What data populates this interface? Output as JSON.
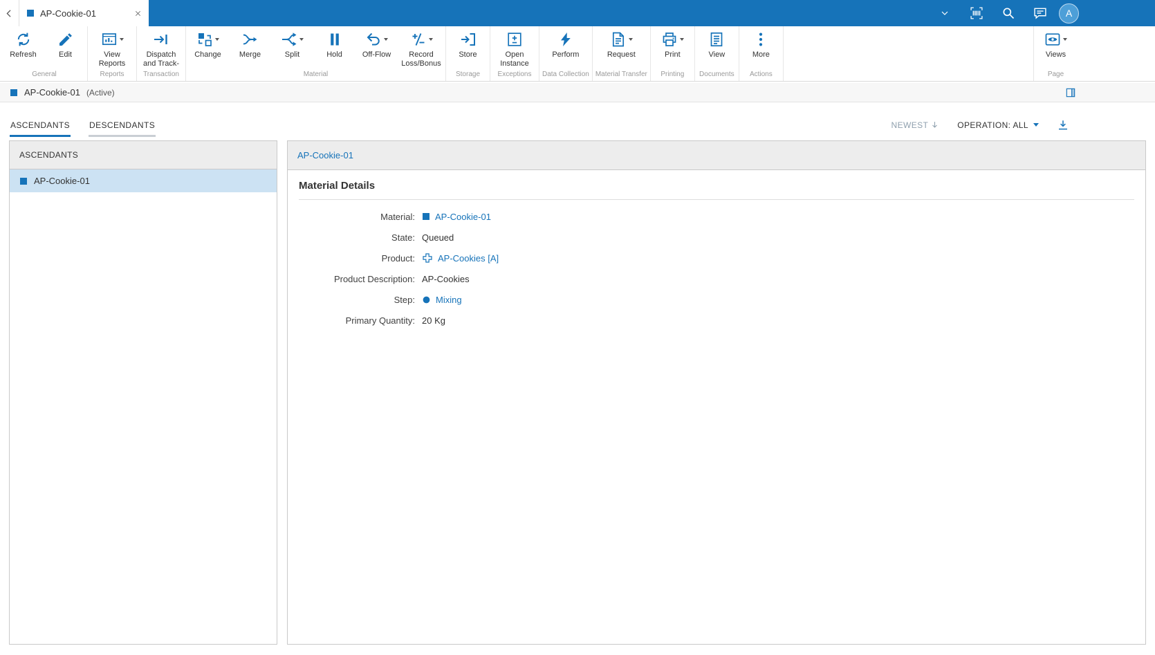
{
  "topbar": {
    "back_icon": "chevron-left",
    "tab": {
      "icon": "material-square",
      "title": "AP-Cookie-01",
      "close_icon": "close"
    },
    "icons": [
      "chevron-down",
      "barcode",
      "search",
      "chat"
    ],
    "avatar": "A"
  },
  "ribbon": {
    "groups": [
      {
        "label": "General",
        "buttons": [
          {
            "label": "Refresh",
            "icon": "refresh",
            "dropdown": false
          },
          {
            "label": "Edit",
            "icon": "edit",
            "dropdown": false
          }
        ]
      },
      {
        "label": "Reports",
        "buttons": [
          {
            "label": "View Reports",
            "icon": "view-reports",
            "dropdown": true
          }
        ]
      },
      {
        "label": "Transaction",
        "buttons": [
          {
            "label": "Dispatch and Track-",
            "icon": "dispatch",
            "dropdown": false
          }
        ]
      },
      {
        "label": "Material",
        "buttons": [
          {
            "label": "Change",
            "icon": "change",
            "dropdown": true
          },
          {
            "label": "Merge",
            "icon": "merge",
            "dropdown": false
          },
          {
            "label": "Split",
            "icon": "split",
            "dropdown": true
          },
          {
            "label": "Hold",
            "icon": "hold",
            "dropdown": false
          },
          {
            "label": "Off-Flow",
            "icon": "off-flow",
            "dropdown": true
          },
          {
            "label": "Record Loss/Bonus",
            "icon": "record-loss-bonus",
            "dropdown": true
          }
        ]
      },
      {
        "label": "Storage",
        "buttons": [
          {
            "label": "Store",
            "icon": "store",
            "dropdown": false
          }
        ]
      },
      {
        "label": "Exceptions",
        "buttons": [
          {
            "label": "Open Instance",
            "icon": "open-instance",
            "dropdown": false
          }
        ]
      },
      {
        "label": "Data Collection",
        "buttons": [
          {
            "label": "Perform",
            "icon": "perform",
            "dropdown": false
          }
        ]
      },
      {
        "label": "Material Transfer",
        "buttons": [
          {
            "label": "Request",
            "icon": "request",
            "dropdown": true
          }
        ]
      },
      {
        "label": "Printing",
        "buttons": [
          {
            "label": "Print",
            "icon": "print",
            "dropdown": true
          }
        ]
      },
      {
        "label": "Documents",
        "buttons": [
          {
            "label": "View",
            "icon": "view-documents",
            "dropdown": false
          }
        ]
      },
      {
        "label": "Actions",
        "buttons": [
          {
            "label": "More",
            "icon": "more",
            "dropdown": false
          }
        ]
      },
      {
        "label": "Page",
        "buttons": [
          {
            "label": "Views",
            "icon": "views",
            "dropdown": true
          }
        ]
      }
    ]
  },
  "titlebar": {
    "icon": "material-square",
    "title": "AP-Cookie-01",
    "status": "(Active)",
    "panel_icon": "panel-toggle"
  },
  "tabs": {
    "items": [
      {
        "label": "ASCENDANTS"
      },
      {
        "label": "DESCENDANTS"
      }
    ],
    "active": "ASCENDANTS",
    "sort_label": "NEWEST",
    "sort_icon": "arrow-down",
    "operation_label": "OPERATION: ALL",
    "download_icon": "download"
  },
  "left_panel": {
    "header": "ASCENDANTS",
    "items": [
      {
        "icon": "material-square",
        "label": "AP-Cookie-01",
        "selected": true
      }
    ]
  },
  "right_panel": {
    "header": "AP-Cookie-01",
    "section_title": "Material Details",
    "fields": [
      {
        "label": "Material:",
        "value": "AP-Cookie-01",
        "icon": "material-square",
        "link": true
      },
      {
        "label": "State:",
        "value": "Queued",
        "link": false
      },
      {
        "label": "Product:",
        "value": "AP-Cookies [A]",
        "icon": "product",
        "link": true
      },
      {
        "label": "Product Description:",
        "value": "AP-Cookies",
        "link": false
      },
      {
        "label": "Step:",
        "value": "Mixing",
        "icon": "step-circle",
        "link": true
      },
      {
        "label": "Primary Quantity:",
        "value": "20 Kg",
        "link": false
      }
    ]
  },
  "colors": {
    "primary": "#1673B9",
    "selected_row": "#CCE2F3",
    "panel_header": "#EDEDED",
    "topbar": "#1673B9"
  }
}
